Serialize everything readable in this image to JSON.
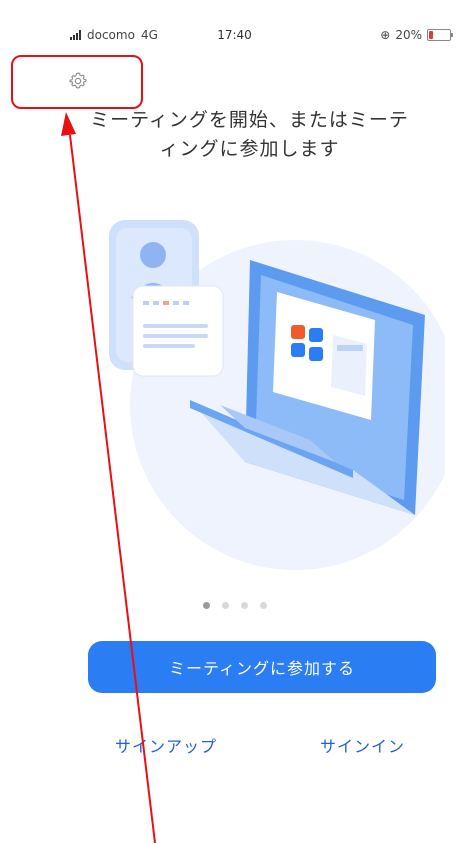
{
  "status_bar": {
    "carrier": "docomo",
    "network": "4G",
    "time": "17:40",
    "battery_pct": "20%",
    "battery_level": 0.2
  },
  "header": {
    "settings_icon": "gear-icon"
  },
  "onboarding": {
    "headline_line1": "ミーティングを開始、またはミーテ",
    "headline_line2": "ィングに参加します",
    "page_count": 4,
    "active_page": 1
  },
  "actions": {
    "join_label": "ミーティングに参加する",
    "signup_label": "サインアップ",
    "signin_label": "サインイン"
  },
  "colors": {
    "primary": "#2a7df2",
    "link": "#2162d5",
    "annotation": "#e81010"
  }
}
